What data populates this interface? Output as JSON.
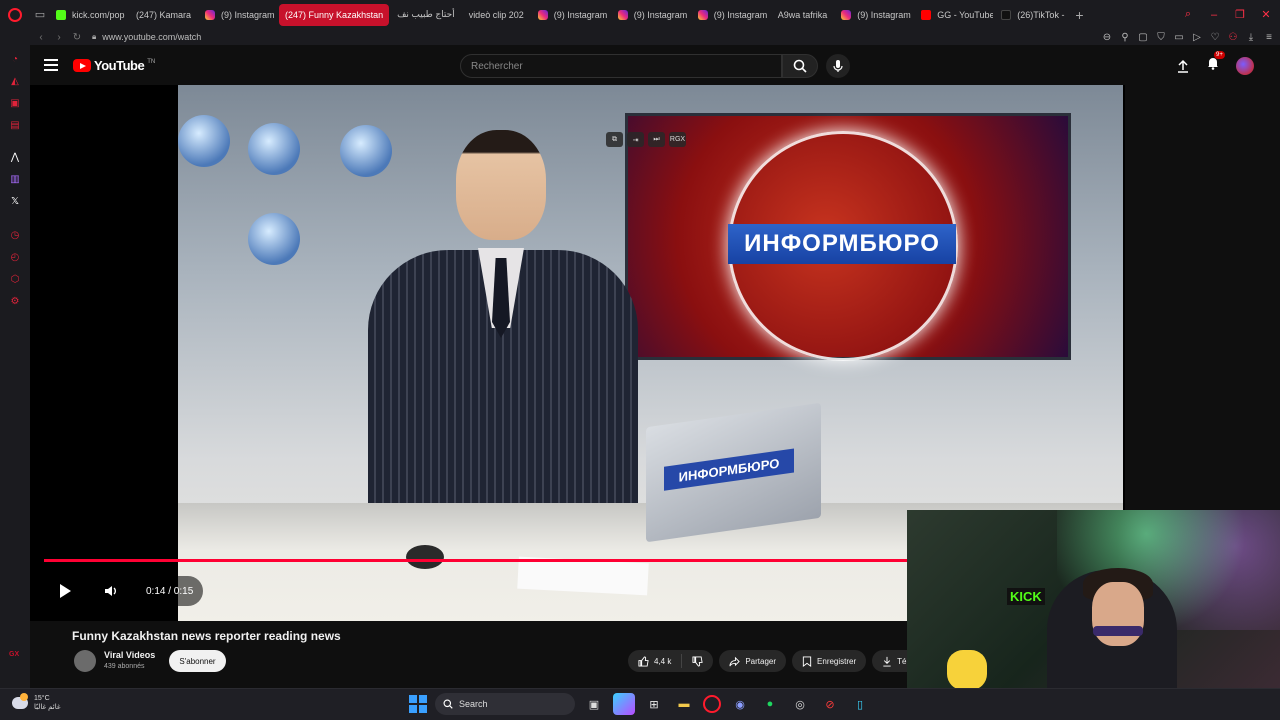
{
  "browser": {
    "tabs": [
      {
        "label": "kick.com/pop",
        "favicon": "kick-icon",
        "active": false
      },
      {
        "label": "(247) Kamara",
        "favicon": "youtube-icon",
        "active": false
      },
      {
        "label": "(9) Instagram",
        "favicon": "instagram-icon",
        "active": false
      },
      {
        "label": "(247) Funny Kazakhstan",
        "favicon": "youtube-icon",
        "active": true
      },
      {
        "label": "أحتاج طبيب نف",
        "favicon": "youtube-icon",
        "active": false
      },
      {
        "label": "videò clip 202",
        "favicon": "youtube-icon",
        "active": false
      },
      {
        "label": "(9) Instagram",
        "favicon": "instagram-icon",
        "active": false
      },
      {
        "label": "(9) Instagram",
        "favicon": "instagram-icon",
        "active": false
      },
      {
        "label": "(9) Instagram",
        "favicon": "instagram-icon",
        "active": false
      },
      {
        "label": "A9wa tafrika",
        "favicon": "youtube-icon",
        "active": false
      },
      {
        "label": "(9) Instagram",
        "favicon": "instagram-icon",
        "active": false
      },
      {
        "label": "GG - YouTube",
        "favicon": "gg-icon",
        "active": false
      },
      {
        "label": "(26)TikTok - ",
        "favicon": "tiktok-icon",
        "active": false
      }
    ],
    "url": "www.youtube.com/watch",
    "accent": "#c7112b"
  },
  "sidebar": {
    "gx_label": "GX"
  },
  "youtube": {
    "logo_text": "YouTube",
    "logo_suffix": "TN",
    "search_placeholder": "Rechercher",
    "notification_count": "9+",
    "player": {
      "time": "0:14 / 0:15",
      "progress_fraction": 0.933,
      "video_caption_screen": "ИНФОРМБЮРО",
      "video_caption_laptop": "ИНФОРМБЮРО",
      "miniplayer_label": "RGX"
    },
    "video": {
      "title": "Funny Kazakhstan news reporter reading news",
      "channel": "Viral Videos",
      "subscribers": "439 abonnés",
      "subscribe_label": "S'abonner",
      "likes": "4,4 k",
      "share_label": "Partager",
      "save_label": "Enregistrer",
      "download_label": "Télé"
    }
  },
  "webcam": {
    "sign_text": "KICK"
  },
  "taskbar": {
    "temperature": "15°C",
    "weather_text": "غائم غالبًا",
    "search_label": "Search"
  }
}
